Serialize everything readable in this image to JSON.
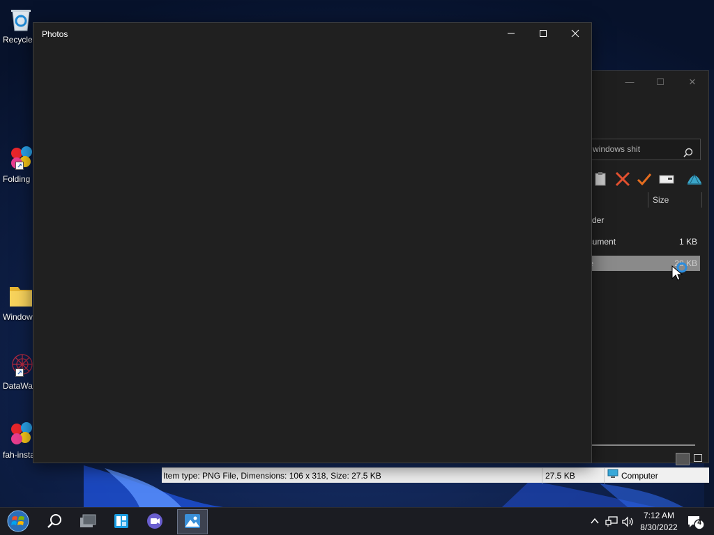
{
  "desktop": {
    "icons": [
      {
        "label": "Recycle",
        "icon": "recycle-bin-icon"
      },
      {
        "label": "Folding",
        "icon": "folding-at-home-icon"
      },
      {
        "label": "Window",
        "icon": "folder-icon"
      },
      {
        "label": "DataWag",
        "icon": "datawag-icon"
      },
      {
        "label": "fah-insta",
        "icon": "fah-installer-icon"
      }
    ]
  },
  "photos_window": {
    "title": "Photos",
    "controls": [
      "minimize-icon",
      "maximize-icon",
      "close-icon"
    ]
  },
  "explorer_window": {
    "search_text": "windows shit",
    "column_header_size": "Size",
    "rows": [
      {
        "name": "der",
        "size": ""
      },
      {
        "name": "ocument",
        "size": "1 KB"
      },
      {
        "name": "ile",
        "size": "28 KB"
      }
    ]
  },
  "statusbar": {
    "info": "Item type: PNG File, Dimensions: 106 x 318, Size: 27.5 KB",
    "size": "27.5 KB",
    "location": "Computer"
  },
  "taskbar": {
    "time": "7:12 AM",
    "date": "8/30/2022",
    "notification_count": "4"
  },
  "colors": {
    "window_bg": "#202020",
    "statusbar_bg": "#f0f0f0",
    "taskbar_bg": "#1b1c22",
    "accent": "#0078d4"
  }
}
